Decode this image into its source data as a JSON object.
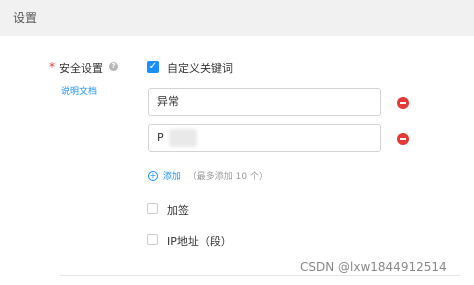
{
  "header": {
    "title": "设置"
  },
  "security": {
    "label": "安全设置",
    "help_icon": "question-circle-icon",
    "doc_link": "说明文档",
    "custom_keywords": {
      "label": "自定义关键词",
      "checked": true
    },
    "keywords": [
      {
        "value": "异常"
      },
      {
        "value": "P"
      }
    ],
    "add": {
      "label": "添加",
      "hint": "（最多添加 10 个）"
    },
    "sign": {
      "label": "加签",
      "checked": false
    },
    "ip": {
      "label": "IP地址（段）",
      "checked": false
    }
  },
  "watermark": "CSDN @lxw1844912514",
  "colors": {
    "accent": "#1890ff",
    "danger": "#e53935"
  }
}
